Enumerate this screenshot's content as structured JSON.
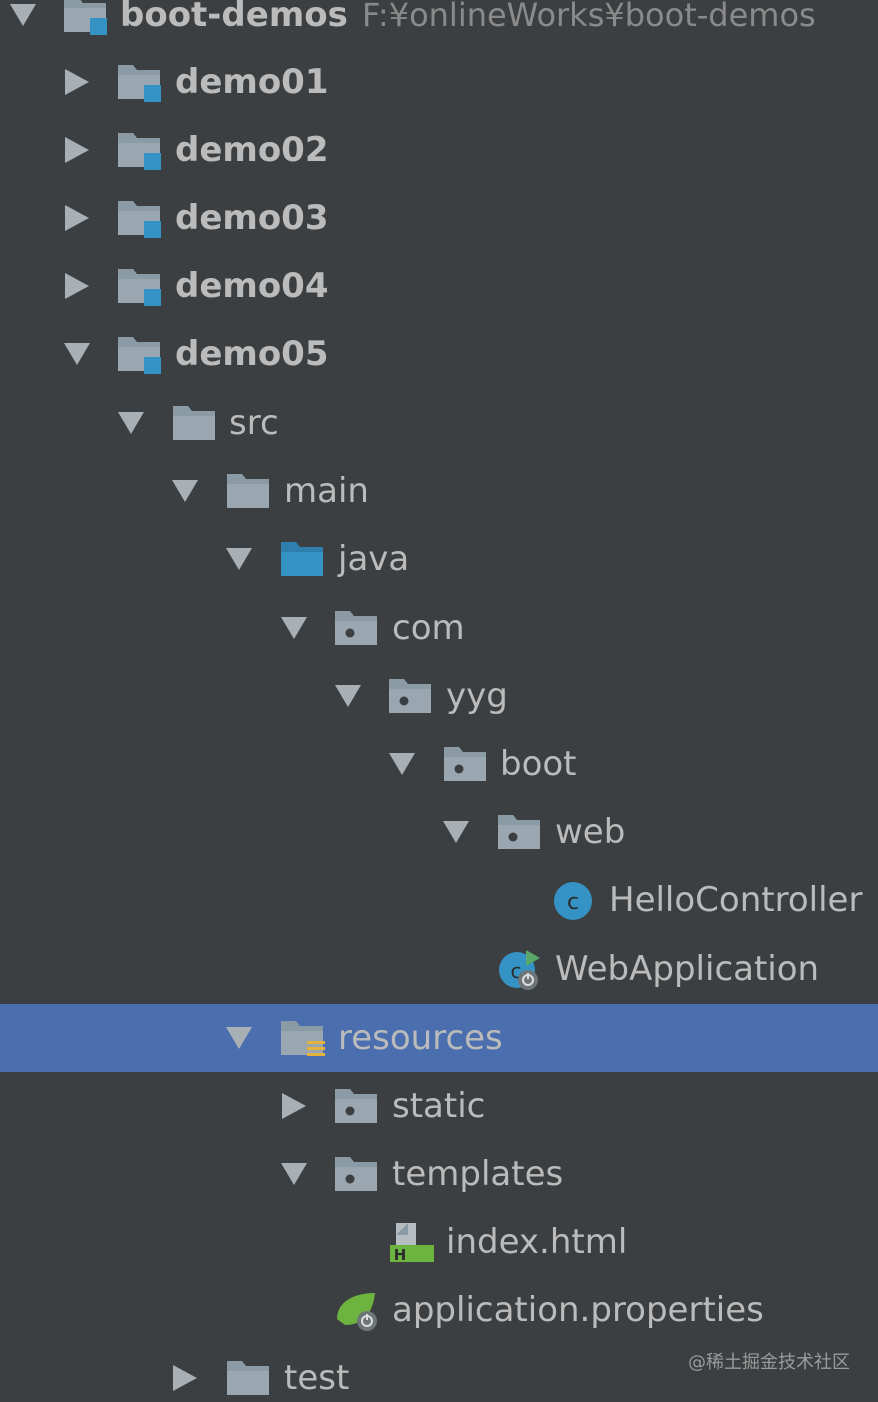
{
  "project": {
    "root_name": "boot-demos",
    "root_path": "F:¥onlineWorks¥boot-demos"
  },
  "tree": {
    "demo01": "demo01",
    "demo02": "demo02",
    "demo03": "demo03",
    "demo04": "demo04",
    "demo05": "demo05",
    "src": "src",
    "main": "main",
    "java": "java",
    "com": "com",
    "yyg": "yyg",
    "boot": "boot",
    "web": "web",
    "hello_controller": "HelloController",
    "web_application": "WebApplication",
    "resources": "resources",
    "static": "static",
    "templates": "templates",
    "index_html": "index.html",
    "application_properties": "application.properties",
    "test": "test"
  },
  "selection": "resources",
  "colors": {
    "background": "#3c3f41",
    "selection": "#4b6eaf",
    "text": "#bbbbbb",
    "folder": "#8b9ba5",
    "source_folder": "#3592c4",
    "module_badge": "#3592c4",
    "spring_green": "#6db33f"
  },
  "watermark": "@稀土掘金技术社区"
}
